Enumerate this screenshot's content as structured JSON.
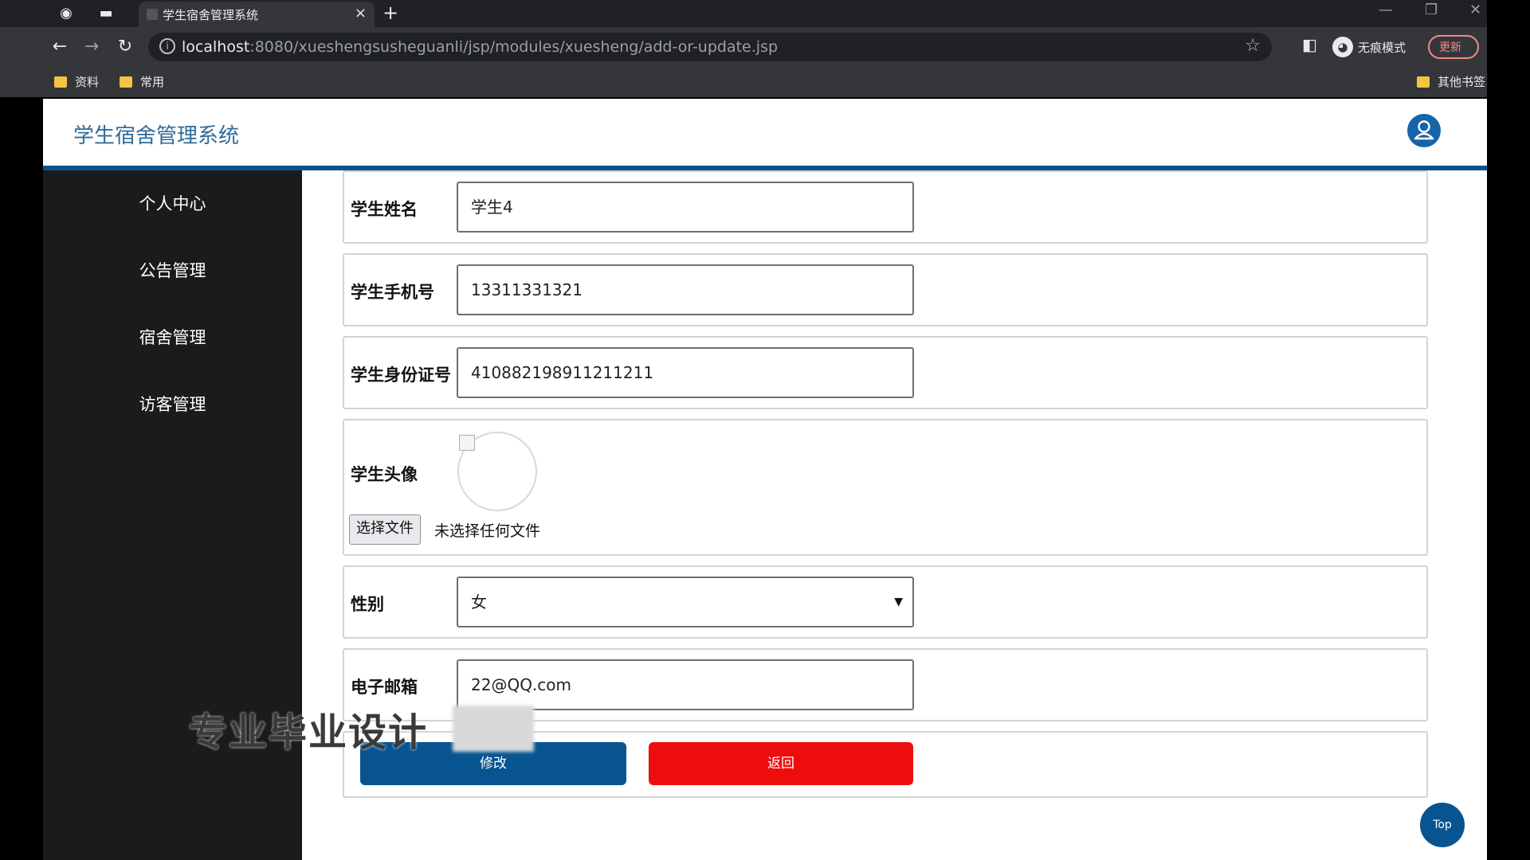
{
  "browser": {
    "tab_title": "学生宿舍管理系统",
    "tab_close": "×",
    "new_tab": "+",
    "url_host": "localhost",
    "url_rest": ":8080/xueshengsusheguanli/jsp/modules/xuesheng/add-or-update.jsp",
    "incognito_label": "无痕模式",
    "update_label": "更新",
    "bookmarks": [
      {
        "label": "资料"
      },
      {
        "label": "常用"
      },
      {
        "label": "其他书签"
      }
    ]
  },
  "header": {
    "title": "学生宿舍管理系统"
  },
  "sidebar": {
    "items": [
      {
        "label": "个人中心"
      },
      {
        "label": "公告管理"
      },
      {
        "label": "宿舍管理"
      },
      {
        "label": "访客管理"
      }
    ]
  },
  "form": {
    "name_label": "学生姓名",
    "name_value": "学生4",
    "phone_label": "学生手机号",
    "phone_value": "13311331321",
    "id_label": "学生身份证号",
    "id_value": "410882198911211211",
    "photo_label": "学生头像",
    "file_button": "选择文件",
    "file_status": "未选择任何文件",
    "gender_label": "性别",
    "gender_value": "女",
    "email_label": "电子邮箱",
    "email_value": "22@QQ.com",
    "submit_label": "修改",
    "back_label": "返回"
  },
  "top_button": "Top",
  "watermark": "专业毕业设计",
  "colors": {
    "primary": "#075491",
    "danger": "#ee0d0d",
    "sidebar_bg": "#1b1b1d",
    "brand_text": "#2f6b98"
  }
}
